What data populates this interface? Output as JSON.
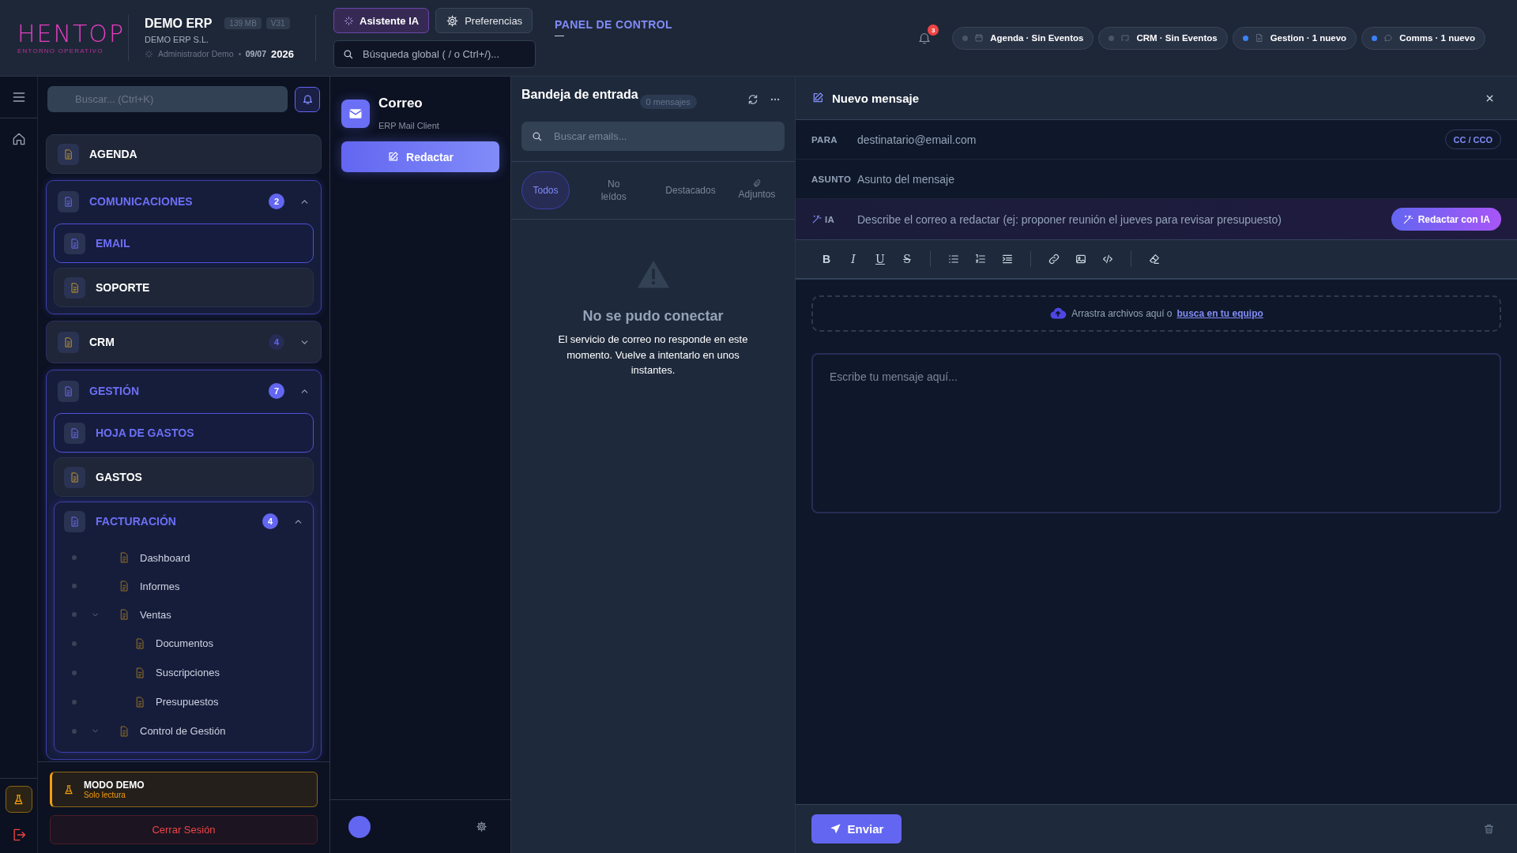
{
  "header": {
    "logo": "HENTOP",
    "tagline": "ENTORNO OPERATIVO",
    "app_name": "DEMO ERP",
    "badges": [
      "139 MB",
      "V31"
    ],
    "company": "DEMO ERP S.L.",
    "user": "Administrador Demo",
    "date": "09/07",
    "year": "2026",
    "ai_button": "Asistente IA",
    "preferences_button": "Preferencias",
    "search": {
      "placeholder": "Búsqueda global ( / o Ctrl+/)..."
    },
    "page_title": "PANEL DE CONTROL",
    "page_subtitle": "—",
    "notification_count": "3",
    "status_chips": [
      {
        "label": "Agenda · Sin Eventos",
        "kind": "calendar",
        "color": "#4b5563"
      },
      {
        "label": "CRM · Sin Eventos",
        "kind": "monitor",
        "color": "#4b5563"
      },
      {
        "label": "Gestion · 1 nuevo",
        "kind": "document",
        "color": "#3b82f6"
      },
      {
        "label": "Comms · 1 nuevo",
        "kind": "chat",
        "color": "#3b82f6"
      }
    ]
  },
  "sidebar": {
    "search": {
      "placeholder": "Buscar... (Ctrl+K)"
    },
    "nav": [
      {
        "label": "AGENDA",
        "selected": false
      },
      {
        "label": "COMUNICACIONES",
        "count": "2",
        "expanded": true,
        "selected": false,
        "children": [
          {
            "label": "EMAIL",
            "selected": true
          },
          {
            "label": "SOPORTE",
            "selected": false
          }
        ]
      },
      {
        "label": "CRM",
        "count": "4",
        "expanded": false,
        "selected": false
      },
      {
        "label": "GESTIÓN",
        "count": "7",
        "expanded": true,
        "selected": false,
        "children": [
          {
            "label": "HOJA DE GASTOS",
            "selected": true
          },
          {
            "label": "GASTOS",
            "selected": false
          },
          {
            "label": "FACTURACIÓN",
            "count": "4",
            "expanded": true,
            "selected": false,
            "children": [
              {
                "label": "Dashboard",
                "selected": false
              },
              {
                "label": "Informes",
                "selected": false
              },
              {
                "label": "Ventas",
                "expanded": true,
                "selected": false,
                "children": [
                  {
                    "label": "Documentos",
                    "selected": false
                  },
                  {
                    "label": "Suscripciones",
                    "selected": false
                  },
                  {
                    "label": "Presupuestos",
                    "selected": false
                  }
                ]
              },
              {
                "label": "Control de Gestión",
                "expanded": true,
                "selected": false
              }
            ]
          }
        ]
      }
    ],
    "demo": {
      "title": "MODO DEMO",
      "subtitle": "Solo lectura"
    },
    "logout_button": "Cerrar Sesión"
  },
  "mail_nav": {
    "title": "Correo",
    "subtitle": "ERP Mail Client",
    "compose_button": "Redactar"
  },
  "inbox": {
    "title": "Bandeja de entrada",
    "count": "0 mensajes",
    "search": {
      "placeholder": "Buscar emails..."
    },
    "tabs": [
      {
        "label": "Todos",
        "selected": true,
        "kind": "text"
      },
      {
        "label": "No leídos",
        "selected": false,
        "kind": "text"
      },
      {
        "label": "Destacados",
        "selected": false,
        "kind": "text"
      },
      {
        "label": "Adjuntos",
        "selected": false,
        "kind": "attachments"
      }
    ],
    "empty": {
      "title": "No se pudo conectar",
      "message": "El servicio de correo no responde en este momento. Vuelve a intentarlo en unos instantes."
    }
  },
  "compose": {
    "title": "Nuevo mensaje",
    "to_label": "PARA",
    "to": {
      "placeholder": "destinatario@email.com"
    },
    "cc_button": "CC / CCO",
    "subject_label": "ASUNTO",
    "subject": {
      "placeholder": "Asunto del mensaje"
    },
    "ai_label": "IA",
    "ai_prompt": {
      "placeholder": "Describe el correo a redactar (ej: proponer reunión el jueves para revisar presupuesto)"
    },
    "ai_button": "Redactar con IA",
    "toolbar": [
      {
        "kind": "bold",
        "glyph": "B"
      },
      {
        "kind": "italic",
        "glyph": "I"
      },
      {
        "kind": "underline",
        "glyph": "U"
      },
      {
        "kind": "strike",
        "glyph": "S"
      },
      {
        "kind": "separator"
      },
      {
        "kind": "bullet_list"
      },
      {
        "kind": "ordered_list"
      },
      {
        "kind": "indent"
      },
      {
        "kind": "separator"
      },
      {
        "kind": "link"
      },
      {
        "kind": "image"
      },
      {
        "kind": "code"
      },
      {
        "kind": "separator"
      },
      {
        "kind": "clear_format"
      }
    ],
    "dropzone_text": "Arrastra archivos aquí o",
    "dropzone_link": "busca en tu equipo",
    "body": {
      "placeholder": "Escribe tu mensaje aquí..."
    },
    "send_button": "Enviar"
  }
}
